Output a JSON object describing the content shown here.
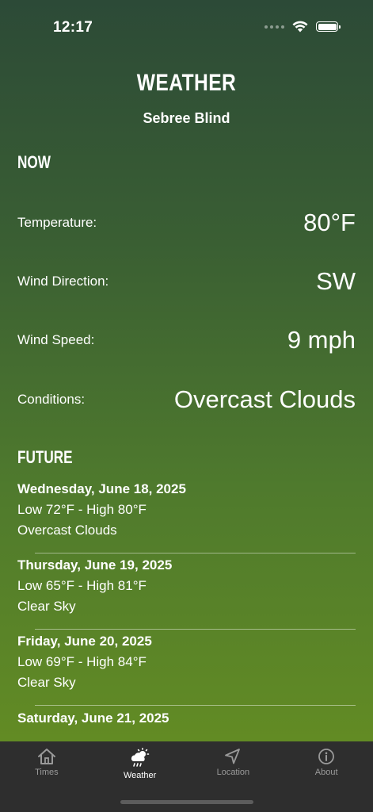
{
  "status_bar": {
    "time": "12:17"
  },
  "header": {
    "title": "WEATHER",
    "location": "Sebree Blind"
  },
  "now": {
    "heading": "NOW",
    "rows": [
      {
        "label": "Temperature:",
        "value": "80°F"
      },
      {
        "label": "Wind Direction:",
        "value": "SW"
      },
      {
        "label": "Wind Speed:",
        "value": "9 mph"
      },
      {
        "label": "Conditions:",
        "value": "Overcast Clouds"
      }
    ]
  },
  "future": {
    "heading": "FUTURE",
    "days": [
      {
        "date": "Wednesday, June 18, 2025",
        "range": "Low 72°F - High 80°F",
        "conditions": "Overcast Clouds"
      },
      {
        "date": "Thursday, June 19, 2025",
        "range": "Low 65°F - High 81°F",
        "conditions": "Clear Sky"
      },
      {
        "date": "Friday, June 20, 2025",
        "range": "Low 69°F - High 84°F",
        "conditions": "Clear Sky"
      },
      {
        "date": "Saturday, June 21, 2025"
      }
    ]
  },
  "tabs": [
    {
      "label": "Times",
      "icon": "home-icon"
    },
    {
      "label": "Weather",
      "icon": "weather-icon",
      "active": true
    },
    {
      "label": "Location",
      "icon": "location-arrow-icon"
    },
    {
      "label": "About",
      "icon": "info-icon"
    }
  ]
}
